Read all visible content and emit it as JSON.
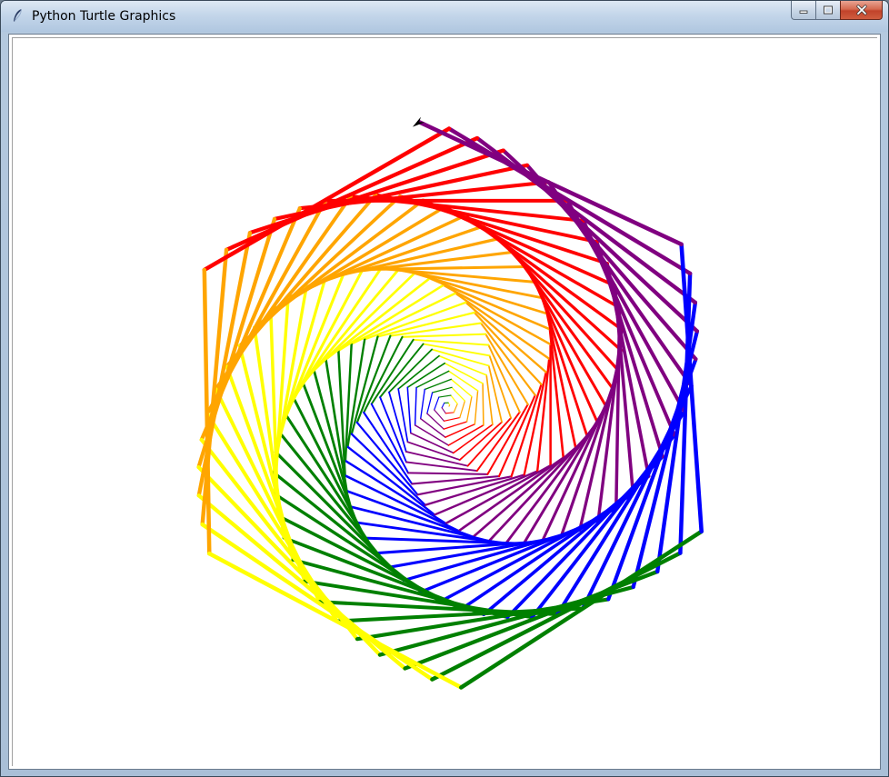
{
  "window": {
    "title": "Python Turtle Graphics"
  },
  "icons": {
    "app": "feather-icon",
    "minimize": "minimize-icon",
    "maximize": "maximize-icon",
    "close": "close-icon",
    "turtle": "turtle-arrow-icon"
  },
  "canvas": {
    "background": "#ffffff",
    "colors": [
      "#ff0000",
      "#ffa500",
      "#ffff00",
      "#008000",
      "#0000ff",
      "#800080"
    ],
    "sides": 6,
    "steps": 216
  }
}
